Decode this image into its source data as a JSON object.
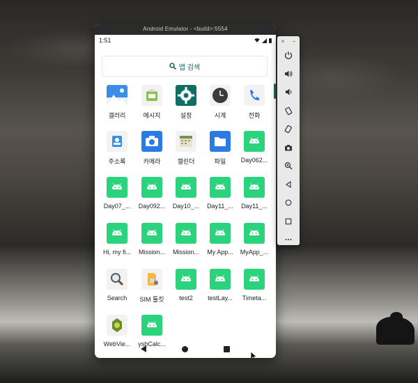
{
  "emulator": {
    "title": "Android Emulator - <build>:5554",
    "time": "1:51",
    "search_label": "앱 검색"
  },
  "apps": [
    {
      "label": "갤러리",
      "icon": "gallery-icon"
    },
    {
      "label": "메시지",
      "icon": "messages-icon"
    },
    {
      "label": "설정",
      "icon": "settings-icon"
    },
    {
      "label": "시계",
      "icon": "clock-icon"
    },
    {
      "label": "전화",
      "icon": "phone-icon"
    },
    {
      "label": "주소록",
      "icon": "contacts-icon"
    },
    {
      "label": "카메라",
      "icon": "camera-icon"
    },
    {
      "label": "캘린더",
      "icon": "calendar-icon"
    },
    {
      "label": "파일",
      "icon": "files-icon"
    },
    {
      "label": "Day062...",
      "icon": "android-icon"
    },
    {
      "label": "Day07_...",
      "icon": "android-icon"
    },
    {
      "label": "Day092...",
      "icon": "android-icon"
    },
    {
      "label": "Day10_...",
      "icon": "android-icon"
    },
    {
      "label": "Day11_...",
      "icon": "android-icon"
    },
    {
      "label": "Day11_...",
      "icon": "android-icon"
    },
    {
      "label": "Hi, my fi...",
      "icon": "android-icon"
    },
    {
      "label": "Mission...",
      "icon": "android-icon"
    },
    {
      "label": "Mission...",
      "icon": "android-icon"
    },
    {
      "label": "My App...",
      "icon": "android-icon"
    },
    {
      "label": "MyApp_...",
      "icon": "android-icon"
    },
    {
      "label": "Search",
      "icon": "magnifier-app-icon"
    },
    {
      "label": "SIM 툴킷",
      "icon": "sim-toolkit-icon"
    },
    {
      "label": "test2",
      "icon": "android-icon"
    },
    {
      "label": "testLay...",
      "icon": "android-icon"
    },
    {
      "label": "Timeta...",
      "icon": "android-icon"
    },
    {
      "label": "WebVie...",
      "icon": "webview-icon"
    },
    {
      "label": "yshCalc...",
      "icon": "android-icon"
    }
  ],
  "toolbar": {
    "close_glyph": "×",
    "minimize_glyph": "−",
    "buttons": [
      "power-icon",
      "volume-up-icon",
      "volume-down-icon",
      "rotate-left-icon",
      "rotate-right-icon",
      "camera-screenshot-icon",
      "zoom-icon",
      "back-icon",
      "home-icon",
      "overview-icon",
      "more-icon"
    ]
  }
}
